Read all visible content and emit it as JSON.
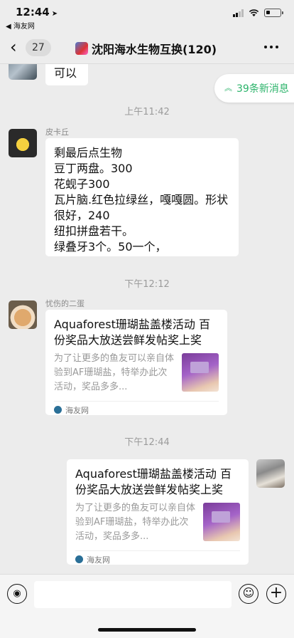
{
  "status": {
    "time": "12:44",
    "location_arrow": "➤",
    "back_app": "◀ 海友网"
  },
  "nav": {
    "unread_count": "27",
    "title": "沈阳海水生物互换(120)"
  },
  "new_messages": {
    "label": "39条新消息",
    "icon": "double-chevron-up-icon"
  },
  "messages": [
    {
      "type": "text",
      "incoming": true,
      "text": "可以"
    },
    {
      "type": "timestamp",
      "text": "上午11:42"
    },
    {
      "type": "text",
      "incoming": true,
      "sender": "皮卡丘",
      "text": "剩最后点生物\n豆丁两盘。300\n花蚬子300\n瓦片脑.红色拉绿丝，嘎嘎圆。形状很好，240\n纽扣拼盘若干。\n绿叠牙3个。50一个，"
    },
    {
      "type": "timestamp",
      "text": "下午12:12"
    },
    {
      "type": "link",
      "incoming": true,
      "sender": "忧伤的二蛋",
      "title": "Aquaforest珊瑚盐盖楼活动 百份奖品大放送尝鲜发帖奖上奖",
      "desc": "为了让更多的鱼友可以亲自体验到AF珊瑚盐，特举办此次活动，奖品多多...",
      "source": "海友网"
    },
    {
      "type": "timestamp",
      "text": "下午12:44"
    },
    {
      "type": "link",
      "incoming": false,
      "title": "Aquaforest珊瑚盐盖楼活动 百份奖品大放送尝鲜发帖奖上奖",
      "desc": "为了让更多的鱼友可以亲自体验到AF珊瑚盐，特举办此次活动，奖品多多...",
      "source": "海友网"
    }
  ],
  "input": {
    "placeholder": ""
  }
}
